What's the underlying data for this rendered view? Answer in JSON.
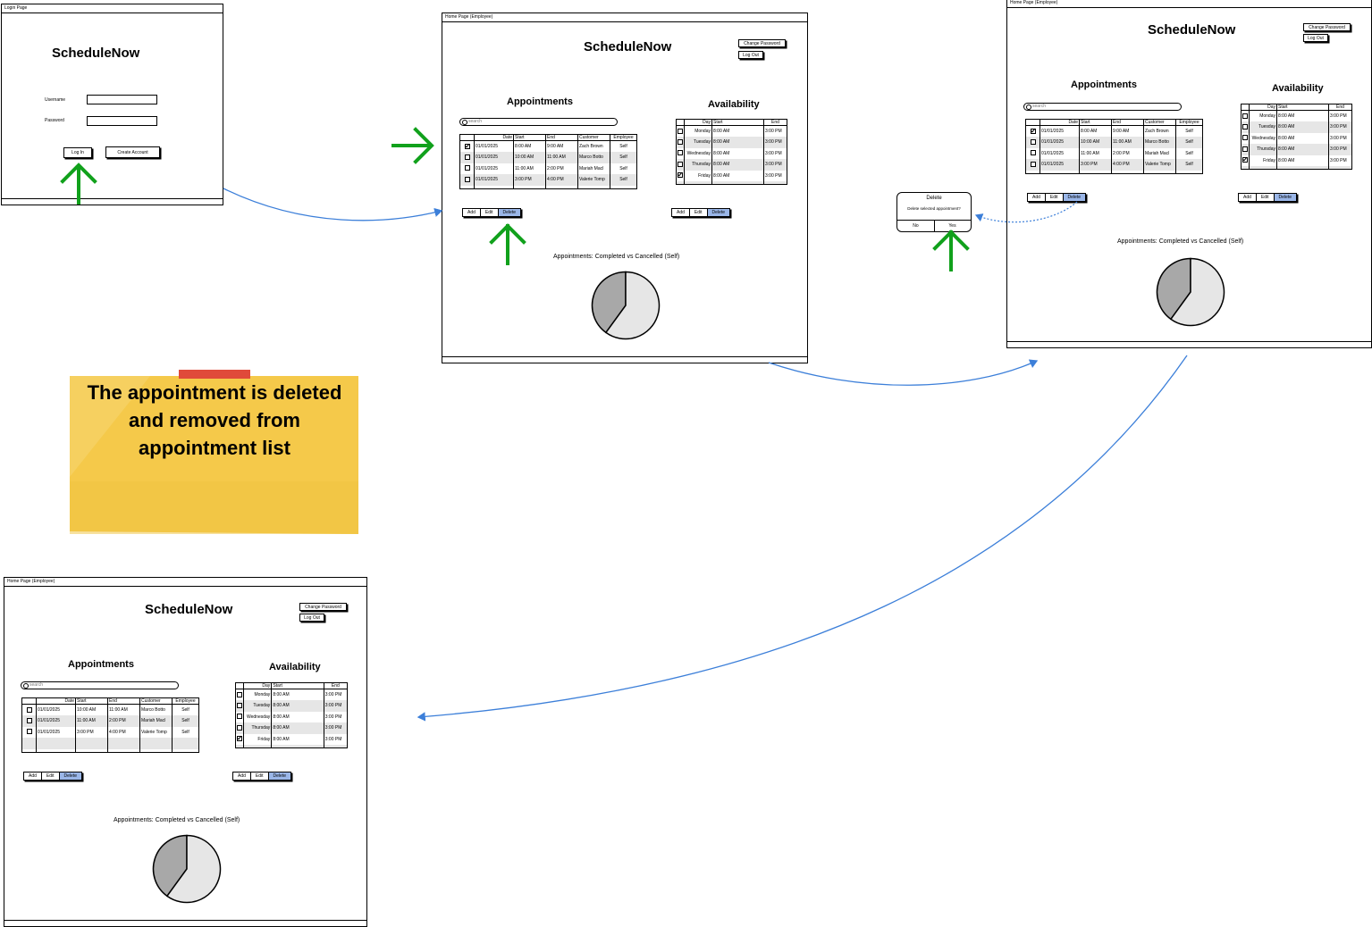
{
  "app_name": "ScheduleNow",
  "login": {
    "title": "Login Page",
    "username_label": "Username",
    "password_label": "Password",
    "login_button": "Log In",
    "create_account_button": "Create Account"
  },
  "home": {
    "title": "Home Page (Employee)",
    "change_password": "Change Password",
    "log_out": "Log Out",
    "appointments_heading": "Appointments",
    "availability_heading": "Availability",
    "search_placeholder": "search",
    "appt_columns": [
      "Date",
      "Start",
      "End",
      "Customer",
      "Employee"
    ],
    "avail_columns": [
      "Day",
      "Start",
      "End"
    ],
    "add": "Add",
    "edit": "Edit",
    "delete": "Delete",
    "chart_title": "Appointments: Completed vs Cancelled (Self)"
  },
  "appointments_before": [
    {
      "date": "01/01/2025",
      "start": "8:00 AM",
      "end": "9:00 AM",
      "customer": "Zach Brown",
      "employee": "Self",
      "checked": true
    },
    {
      "date": "01/01/2025",
      "start": "10:00 AM",
      "end": "11:00 AM",
      "customer": "Marco Botto",
      "employee": "Self",
      "checked": false
    },
    {
      "date": "01/01/2025",
      "start": "11:00 AM",
      "end": "2:00 PM",
      "customer": "Mariah Macl",
      "employee": "Self",
      "checked": false
    },
    {
      "date": "01/01/2025",
      "start": "3:00 PM",
      "end": "4:00 PM",
      "customer": "Valerie Tomp",
      "employee": "Self",
      "checked": false
    }
  ],
  "appointments_after": [
    {
      "date": "01/01/2025",
      "start": "10:00 AM",
      "end": "11:00 AM",
      "customer": "Marco Botto",
      "employee": "Self",
      "checked": false
    },
    {
      "date": "01/01/2025",
      "start": "11:00 AM",
      "end": "2:00 PM",
      "customer": "Mariah Macl",
      "employee": "Self",
      "checked": false
    },
    {
      "date": "01/01/2025",
      "start": "3:00 PM",
      "end": "4:00 PM",
      "customer": "Valerie Tomp",
      "employee": "Self",
      "checked": false
    }
  ],
  "availability": [
    {
      "day": "Monday",
      "start": "8:00 AM",
      "end": "3:00 PM",
      "checked": false
    },
    {
      "day": "Tuesday",
      "start": "8:00 AM",
      "end": "3:00 PM",
      "checked": false
    },
    {
      "day": "Wednesday",
      "start": "8:00 AM",
      "end": "3:00 PM",
      "checked": false
    },
    {
      "day": "Thursday",
      "start": "8:00 AM",
      "end": "3:00 PM",
      "checked": false
    },
    {
      "day": "Friday",
      "start": "8:00 AM",
      "end": "3:00 PM",
      "checked": true
    }
  ],
  "pie_chart": {
    "type": "pie",
    "slices": [
      {
        "value": 0.4,
        "color": "#a8a8a8"
      },
      {
        "value": 0.6,
        "color": "#e6e6e6"
      }
    ]
  },
  "dialog": {
    "title": "Delete",
    "message": "Delete selected appointment?",
    "no": "No",
    "yes": "Yes"
  },
  "note": {
    "text": "The appointment is deleted and removed from appointment list",
    "color": "#f5c94a"
  },
  "colors": {
    "arrow_green": "#11a11c",
    "connector_blue": "#3c7fd9",
    "button_selected": "#9ab6e8"
  }
}
